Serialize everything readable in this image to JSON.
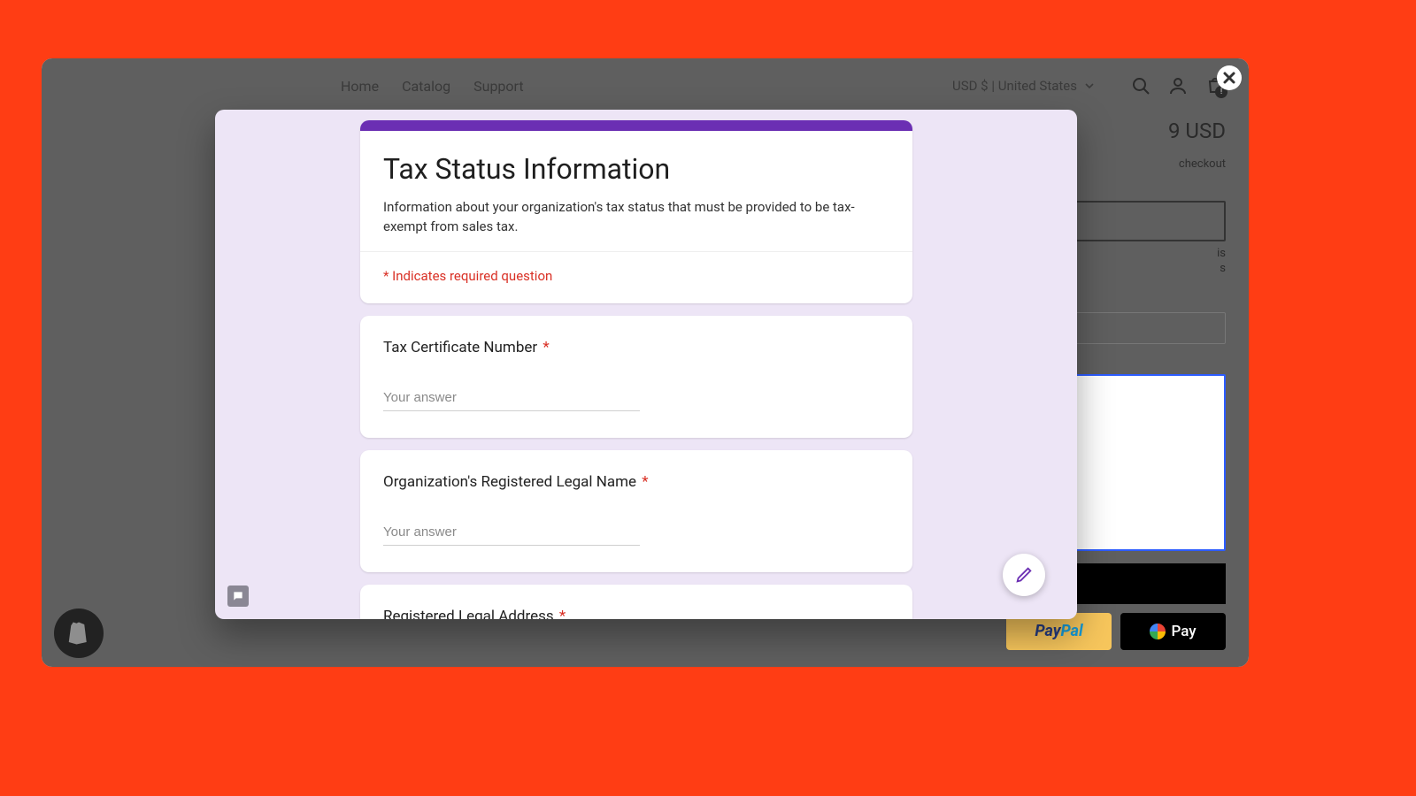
{
  "nav": {
    "links": [
      "Home",
      "Catalog",
      "Support"
    ],
    "region": "USD $ | United States",
    "cart_badge": "!"
  },
  "product": {
    "price_fragment": "9 USD",
    "shipping_fragment": "checkout",
    "small_line1": "is",
    "small_line2": "s"
  },
  "pay": {
    "paypal_p": "Pay",
    "paypal_pal": "Pal",
    "gpay": "Pay"
  },
  "form": {
    "title": "Tax Status Information",
    "description": "Information about your organization's tax status that must be provided to be tax-exempt from sales tax.",
    "required_note": "* Indicates required question",
    "placeholder": "Your answer",
    "questions": [
      {
        "label": "Tax Certificate Number",
        "required": true
      },
      {
        "label": "Organization's Registered Legal Name",
        "required": true
      },
      {
        "label": "Registered Legal Address",
        "required": true
      }
    ]
  }
}
